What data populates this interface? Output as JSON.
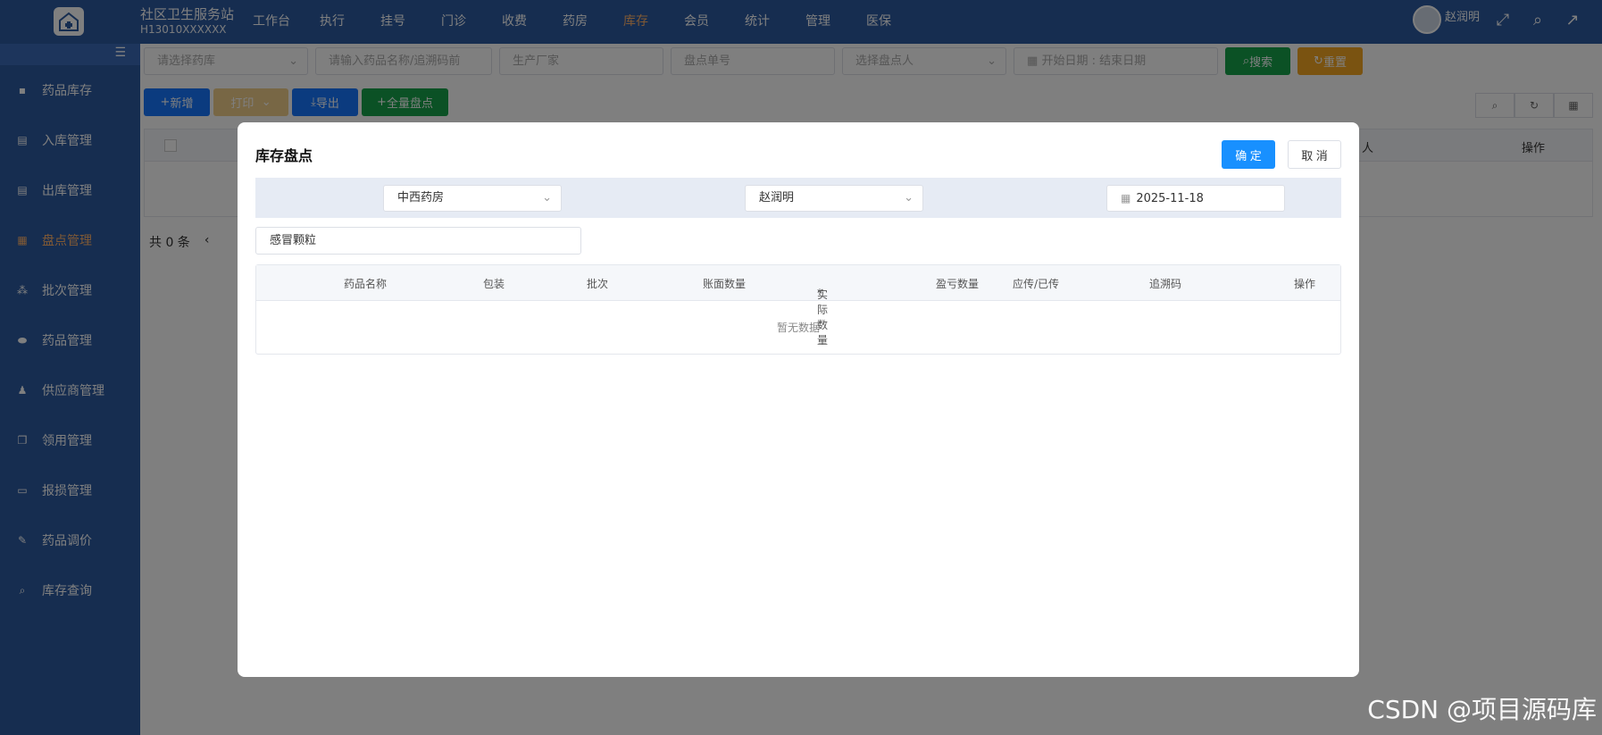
{
  "header": {
    "brand_title": "社区卫生服务站",
    "brand_code": "H13010XXXXXX",
    "nav": [
      "工作台",
      "执行",
      "挂号",
      "门诊",
      "收费",
      "药房",
      "库存",
      "会员",
      "统计",
      "管理",
      "医保"
    ],
    "active_nav": "库存",
    "user_name": "赵润明"
  },
  "sidebar": {
    "items": [
      {
        "label": "药品库存",
        "icon": "medicine-bottle-icon"
      },
      {
        "label": "入库管理",
        "icon": "document-in-icon"
      },
      {
        "label": "出库管理",
        "icon": "document-out-icon"
      },
      {
        "label": "盘点管理",
        "icon": "inventory-icon"
      },
      {
        "label": "批次管理",
        "icon": "batch-icon"
      },
      {
        "label": "药品管理",
        "icon": "pill-icon"
      },
      {
        "label": "供应商管理",
        "icon": "supplier-icon"
      },
      {
        "label": "领用管理",
        "icon": "copy-icon"
      },
      {
        "label": "报损管理",
        "icon": "monitor-icon"
      },
      {
        "label": "药品调价",
        "icon": "edit-icon"
      },
      {
        "label": "库存查询",
        "icon": "search-stock-icon"
      }
    ],
    "active": "盘点管理"
  },
  "filters": {
    "pharmacy_placeholder": "请选择药库",
    "drug_placeholder": "请输入药品名称/追溯码前",
    "manufacturer_placeholder": "生产厂家",
    "order_placeholder": "盘点单号",
    "checker_placeholder": "选择盘点人",
    "start_date": "开始日期",
    "date_sep": ":",
    "end_date": "结束日期",
    "search_label": "搜索",
    "reset_label": "重置"
  },
  "actions": {
    "add_label": "新增",
    "print_label": "打印",
    "export_label": "导出",
    "full_count_label": "全量盘点"
  },
  "background_table": {
    "col_person_partial": "人",
    "col_ops": "操作",
    "total": "共 0 条"
  },
  "modal": {
    "title": "库存盘点",
    "ok_label": "确 定",
    "cancel_label": "取 消",
    "pharmacy": "中西药房",
    "checker": "赵润明",
    "date": "2025-11-18",
    "search_value": "感冒颗粒",
    "columns": [
      "药品名称",
      "包装",
      "批次",
      "账面数量",
      "实际数量",
      "盈亏数量",
      "应传/已传",
      "追溯码",
      "操作"
    ],
    "required_mark": "*",
    "empty_text": "暂无数据"
  },
  "watermark": "CSDN @项目源码库",
  "colors": {
    "primary_nav": "#2d5aa0",
    "active_accent": "#ffb26b",
    "confirm_blue": "#1890ff",
    "search_green": "#16a34a",
    "reset_orange": "#f5a623"
  }
}
